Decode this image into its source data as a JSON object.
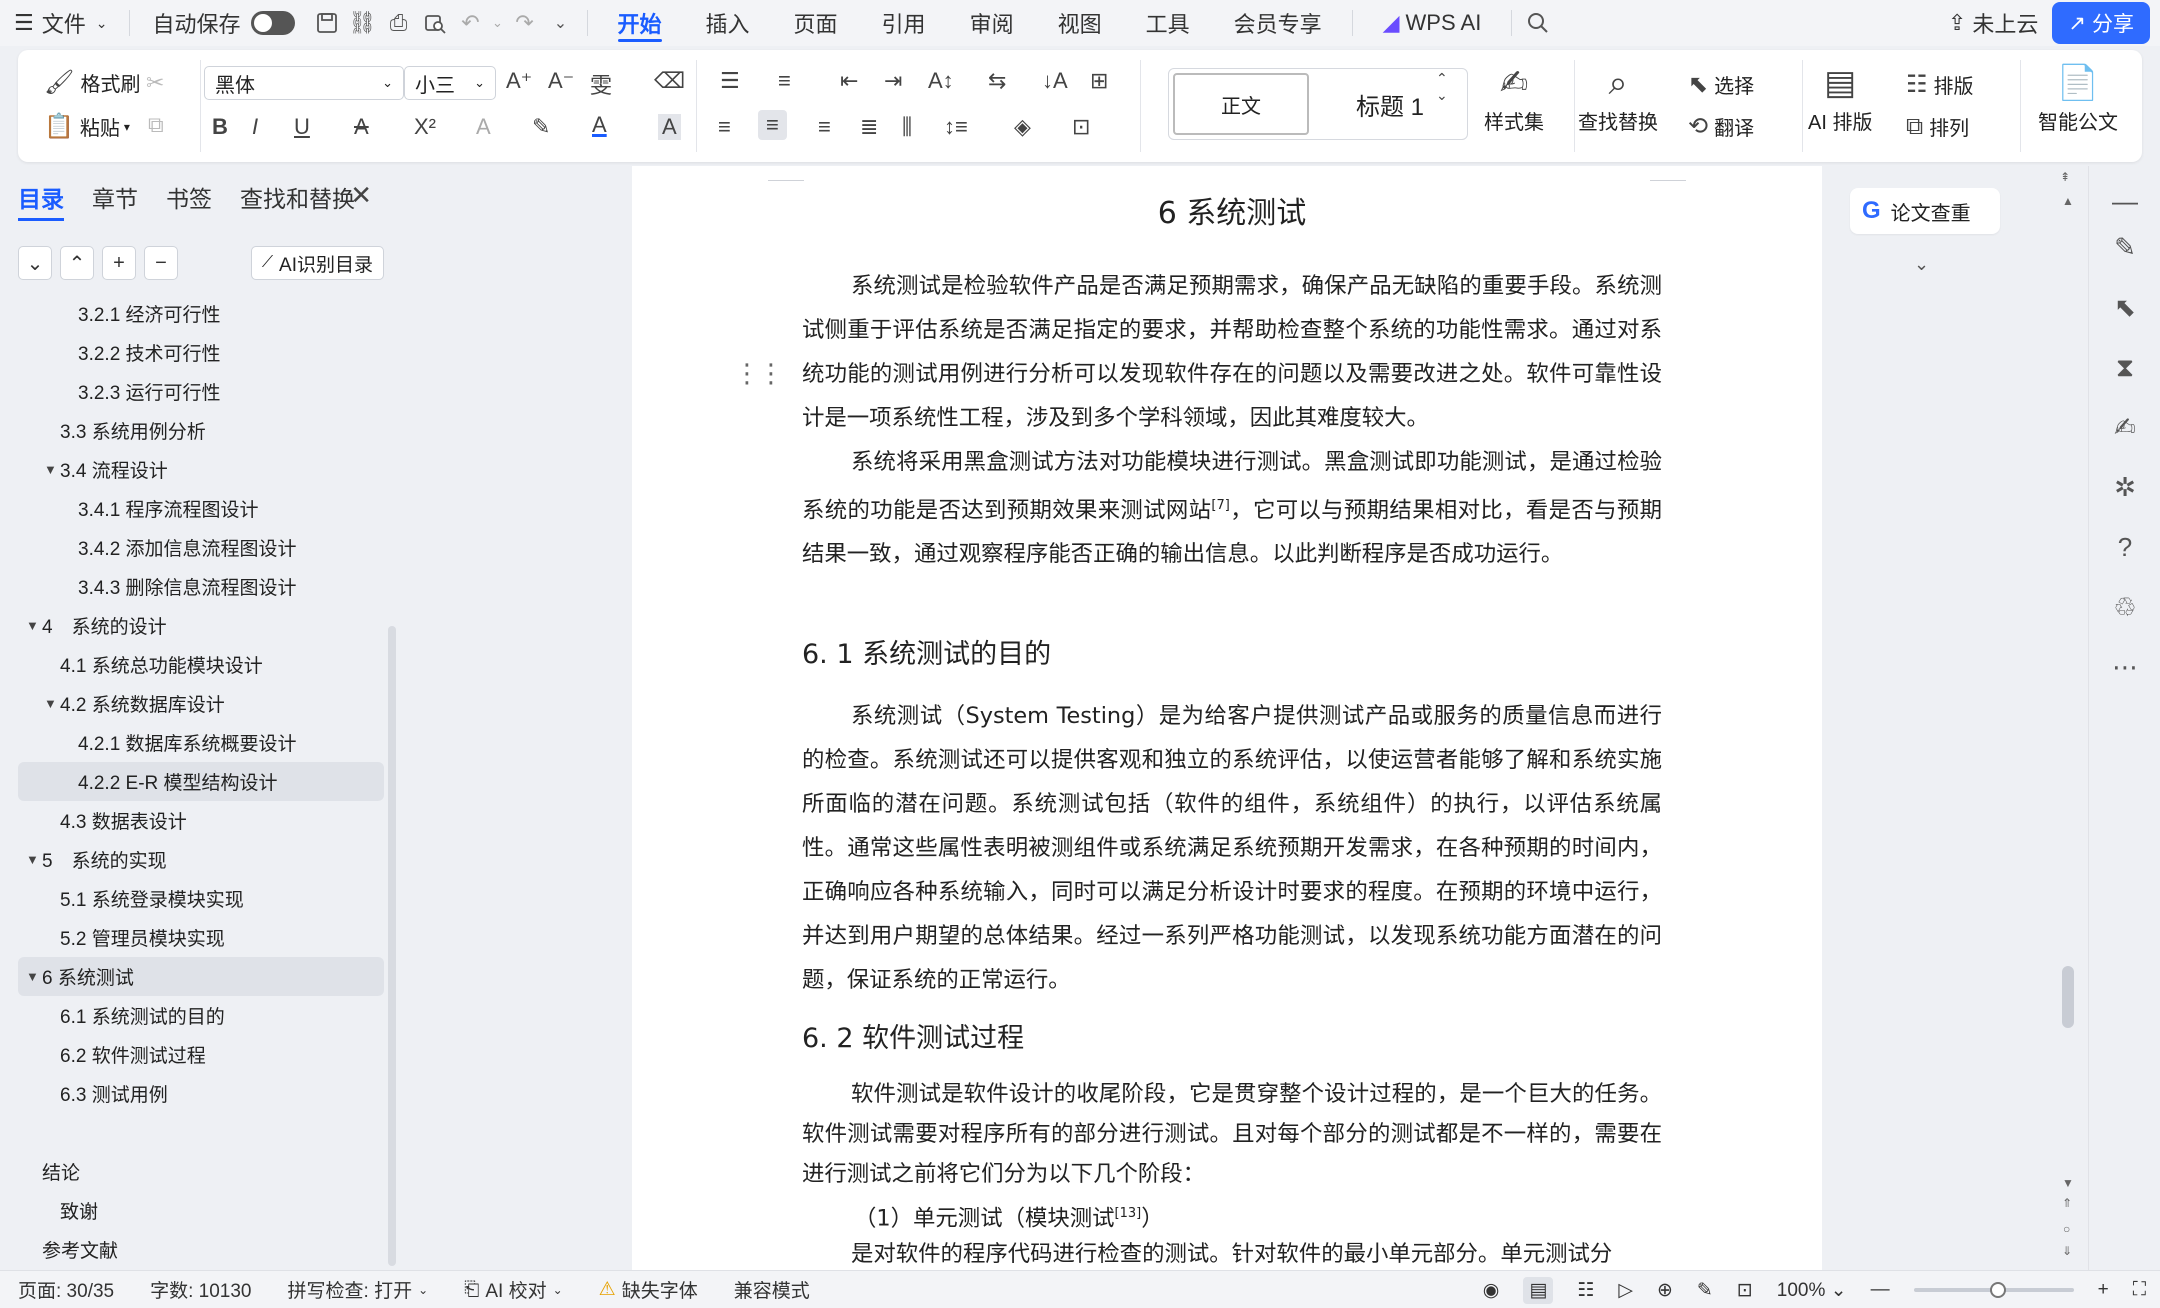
{
  "menubar": {
    "file": "文件",
    "autosave": "自动保存",
    "tabs": [
      "开始",
      "插入",
      "页面",
      "引用",
      "审阅",
      "视图",
      "工具",
      "会员专享"
    ],
    "active_tab": "开始",
    "wps_ai": "WPS AI",
    "cloud": "未上云",
    "share": "分享"
  },
  "ribbon": {
    "format_painter": "格式刷",
    "paste": "粘贴",
    "font_name": "黑体",
    "font_size": "小三",
    "style_normal": "正文",
    "style_heading": "标题 1",
    "style_set": "样式集",
    "find_replace": "查找替换",
    "select": "选择",
    "translate": "翻译",
    "ai_layout": "AI 排版",
    "layout": "排版",
    "arrange": "排列",
    "smart_doc": "智能公文"
  },
  "nav": {
    "tabs": [
      "目录",
      "章节",
      "书签",
      "查找和替换"
    ],
    "ai_toc": "AI识别目录",
    "items": [
      {
        "label": "3.2.1 经济可行性",
        "level": 3
      },
      {
        "label": "3.2.2 技术可行性",
        "level": 3
      },
      {
        "label": "3.2.3 运行可行性",
        "level": 3
      },
      {
        "label": "3.3 系统用例分析",
        "level": 2
      },
      {
        "label": "3.4 流程设计",
        "level": 2,
        "expanded": true
      },
      {
        "label": "3.4.1 程序流程图设计",
        "level": 3
      },
      {
        "label": "3.4.2 添加信息流程图设计",
        "level": 3
      },
      {
        "label": "3.4.3 删除信息流程图设计",
        "level": 3
      },
      {
        "label": "4　系统的设计",
        "level": 1,
        "expanded": true
      },
      {
        "label": "4.1 系统总功能模块设计",
        "level": 2
      },
      {
        "label": "4.2 系统数据库设计",
        "level": 2,
        "expanded": true
      },
      {
        "label": "4.2.1 数据库系统概要设计",
        "level": 3
      },
      {
        "label": "4.2.2 E-R 模型结构设计",
        "level": 3,
        "selected": true
      },
      {
        "label": "4.3 数据表设计",
        "level": 2
      },
      {
        "label": "5　系统的实现",
        "level": 1,
        "expanded": true
      },
      {
        "label": "5.1 系统登录模块实现",
        "level": 2
      },
      {
        "label": "5.2 管理员模块实现",
        "level": 2
      },
      {
        "label": "6 系统测试",
        "level": 1,
        "expanded": true,
        "current": true
      },
      {
        "label": "6.1 系统测试的目的",
        "level": 2
      },
      {
        "label": "6.2 软件测试过程",
        "level": 2
      },
      {
        "label": "6.3 测试用例",
        "level": 2
      },
      {
        "label": "",
        "level": 0
      },
      {
        "label": "结论",
        "level": 1,
        "noarrow": true
      },
      {
        "label": "致谢",
        "level": 2,
        "noarrow": true
      },
      {
        "label": "参考文献",
        "level": 1,
        "noarrow": true
      }
    ]
  },
  "doc": {
    "title": "6 系统测试",
    "p1": "系统测试是检验软件产品是否满足预期需求，确保产品无缺陷的重要手段。系统测试侧重于评估系统是否满足指定的要求，并帮助检查整个系统的功能性需求。通过对系统功能的测试用例进行分析可以发现软件存在的问题以及需要改进之处。软件可靠性设计是一项系统性工程，涉及到多个学科领域，因此其难度较大。",
    "p2a": "系统将采用黑盒测试方法对功能模块进行测试。黑盒测试即功能测试，是通过检验系统的功能是否达到预期效果来测试网站",
    "p2_ref": "[7]",
    "p2b": "，它可以与预期结果相对比，看是否与预期结果一致，通过观察程序能否正确的输出信息。以此判断程序是否成功运行。",
    "h61": "6. 1 系统测试的目的",
    "p3": "系统测试（System Testing）是为给客户提供测试产品或服务的质量信息而进行的检查。系统测试还可以提供客观和独立的系统评估，以使运营者能够了解和系统实施所面临的潜在问题。系统测试包括（软件的组件，系统组件）的执行，以评估系统属性。通常这些属性表明被测组件或系统满足系统预期开发需求，在各种预期的时间内，正确响应各种系统输入，同时可以满足分析设计时要求的程度。在预期的环境中运行，并达到用户期望的总体结果。经过一系列严格功能测试，以发现系统功能方面潜在的问题，保证系统的正常运行。",
    "h62": "6. 2 软件测试过程",
    "p4": "软件测试是软件设计的收尾阶段，它是贯穿整个设计过程的，是一个巨大的任务。软件测试需要对程序所有的部分进行测试。且对每个部分的测试都是不一样的，需要在进行测试之前将它们分为以下几个阶段：",
    "p5a": "（1）单元测试（模块测试",
    "p5_ref": "[13]",
    "p5b": "）",
    "p6": "是对软件的程序代码进行检查的测试。针对软件的最小单元部分。单元测试分"
  },
  "side": {
    "paper_check": "论文查重"
  },
  "status": {
    "page": "页面: 30/35",
    "words": "字数: 10130",
    "spell": "拼写检查: 打开",
    "ai_proof": "AI 校对",
    "missing_font": "缺失字体",
    "compat": "兼容模式",
    "zoom": "100%"
  },
  "colors": {
    "accent": "#1a5cff",
    "share_bg": "#2f6bff"
  }
}
